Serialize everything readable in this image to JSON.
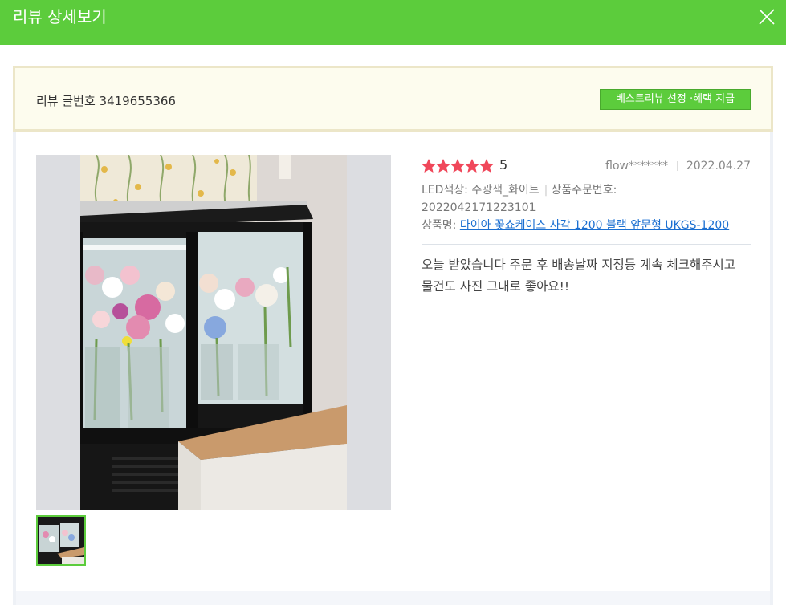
{
  "header": {
    "title": "리뷰 상세보기"
  },
  "notice": {
    "review_no_label": "리뷰 글번호 3419655366",
    "best_badge": "베스트리뷰 선정 ·혜택 지급"
  },
  "review": {
    "rating": 5,
    "rating_text": "5",
    "author": "flow*******",
    "date": "2022.04.27",
    "option_label": "LED색상: 주광색_화이트",
    "order_label": "상품주문번호:",
    "order_number": "2022042171223101",
    "product_label": "상품명:",
    "product_name": "다이아 꽃쇼케이스 사각 1200 블랙 앞문형 UKGS-1200",
    "body": "오늘 받았습니다 주문 후 배송날짜 지정등 계속 체크해주시고 물건도 사진 그대로 좋아요!!"
  },
  "colors": {
    "header_green": "#5ccc3c",
    "star_red": "#f0475a",
    "link_blue": "#1b6fd1"
  },
  "icons": {
    "close": "close-icon",
    "star": "star-icon"
  }
}
